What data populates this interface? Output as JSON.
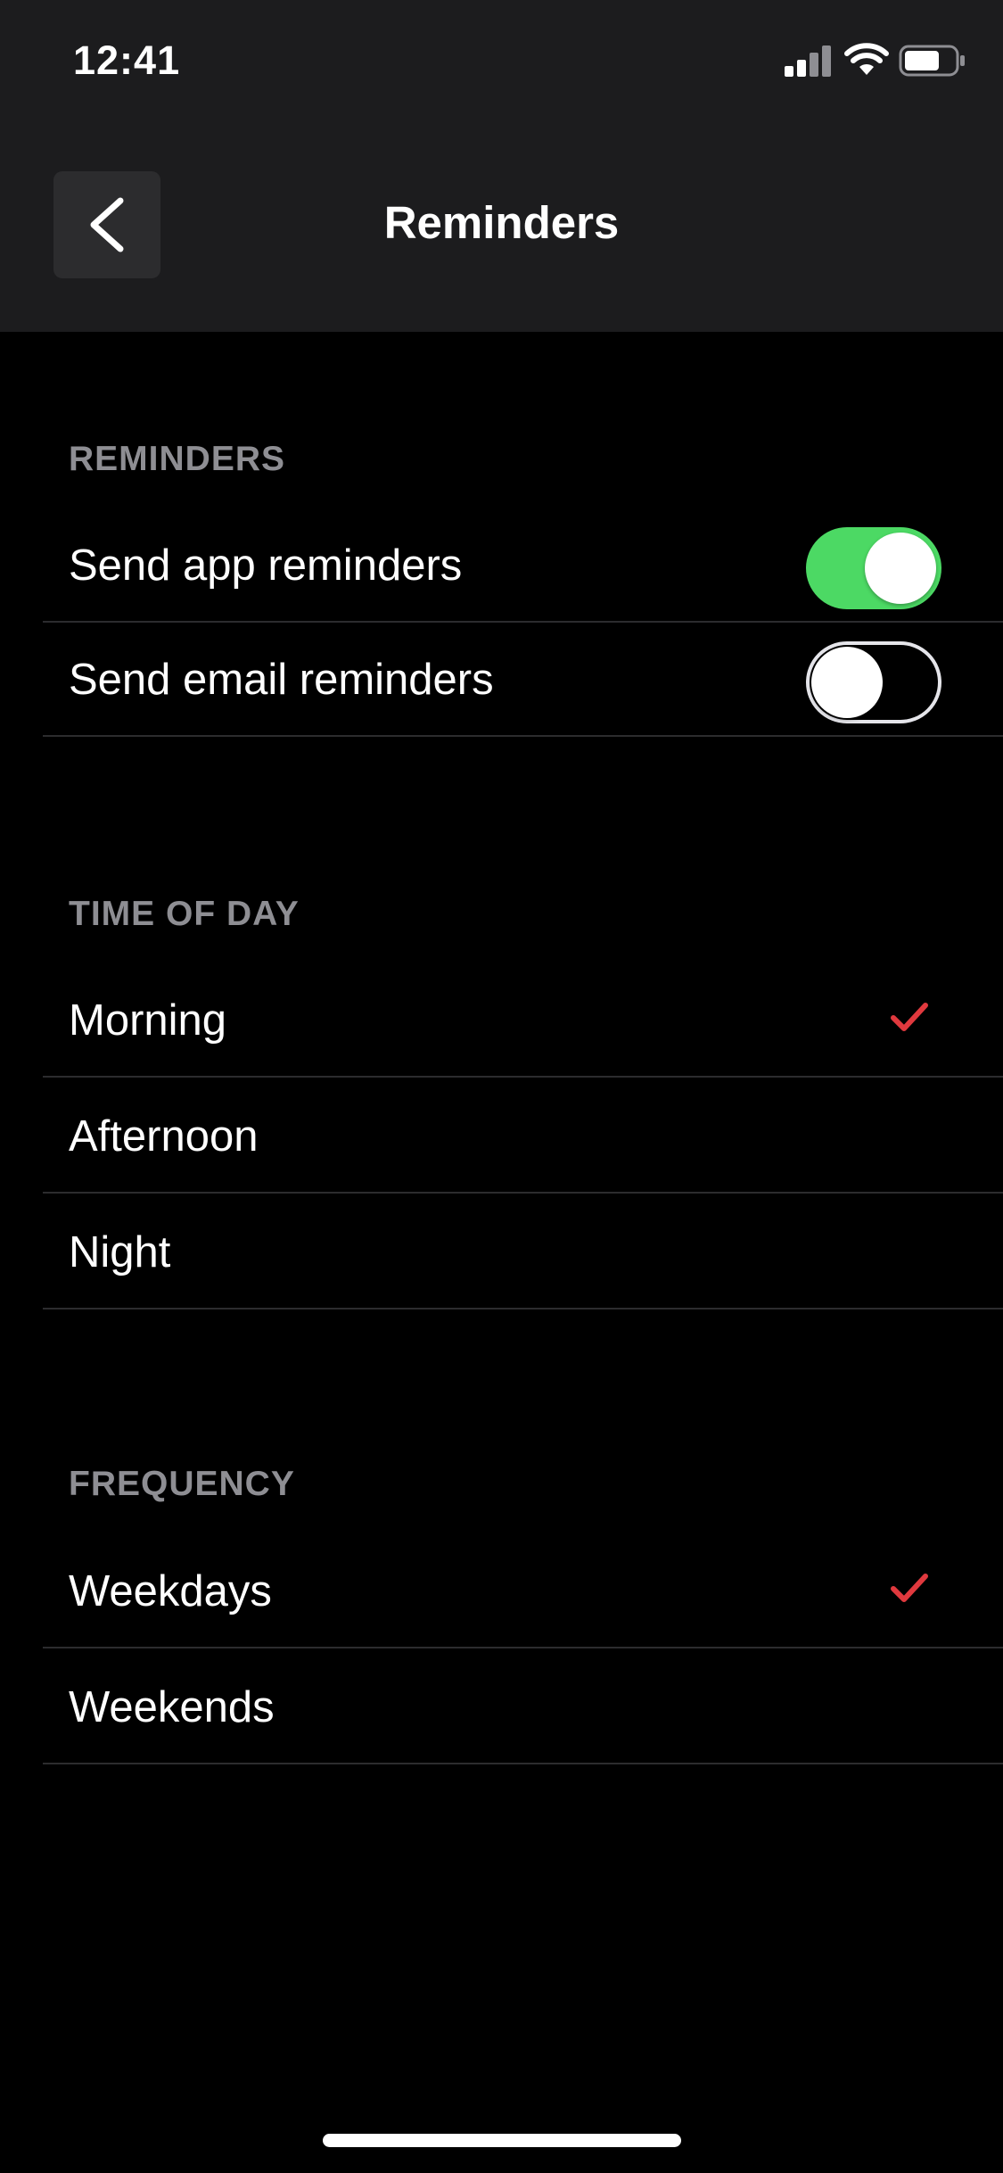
{
  "status_bar": {
    "time": "12:41"
  },
  "nav": {
    "title": "Reminders",
    "back_icon": "chevron-left-icon"
  },
  "sections": {
    "reminders": {
      "header": "REMINDERS",
      "items": [
        {
          "label": "Send app reminders",
          "toggle_on": true
        },
        {
          "label": "Send email reminders",
          "toggle_on": false
        }
      ]
    },
    "time_of_day": {
      "header": "TIME OF DAY",
      "items": [
        {
          "label": "Morning",
          "selected": true
        },
        {
          "label": "Afternoon",
          "selected": false
        },
        {
          "label": "Night",
          "selected": false
        }
      ]
    },
    "frequency": {
      "header": "FREQUENCY",
      "items": [
        {
          "label": "Weekdays",
          "selected": true
        },
        {
          "label": "Weekends",
          "selected": false
        }
      ]
    }
  },
  "colors": {
    "toggle_on": "#4cd964",
    "checkmark": "#e0393e",
    "header_text": "#8e8e93",
    "nav_background": "#1c1c1e"
  }
}
